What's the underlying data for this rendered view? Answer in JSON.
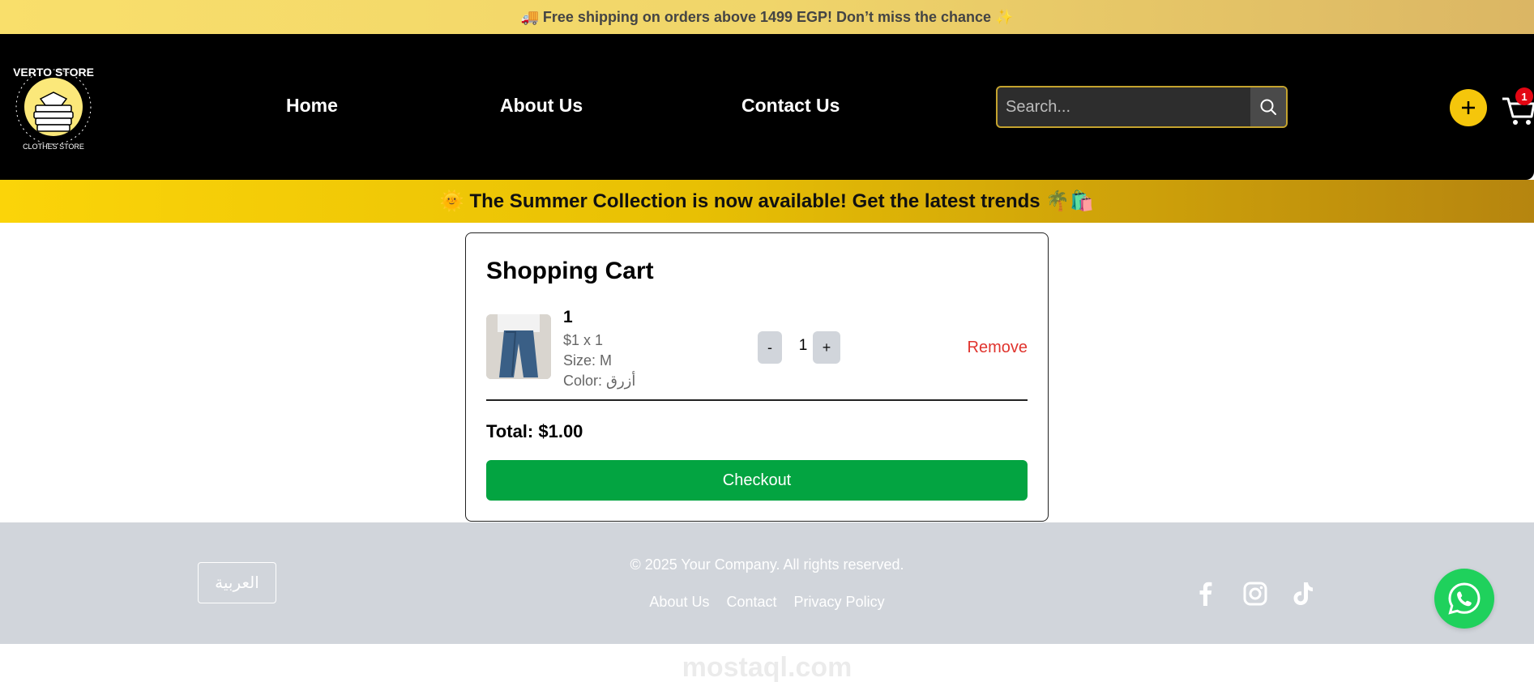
{
  "promo": {
    "text": "🚚 Free shipping on orders above 1499 EGP! Don’t miss the chance ✨"
  },
  "header": {
    "logo": {
      "top_text": "VERTO STORE",
      "bottom_text": "CLOTHES STORE"
    },
    "nav": [
      "Home",
      "About Us",
      "Contact Us"
    ],
    "search": {
      "placeholder": "Search..."
    },
    "cart_count": "1"
  },
  "banner": {
    "text": "🌞 The Summer Collection is now available! Get the latest trends 🌴🛍️"
  },
  "cart": {
    "title": "Shopping Cart",
    "item": {
      "name": "1",
      "price_line": "$1 x 1",
      "size_line": "Size: M",
      "color_line": "Color: أزرق",
      "quantity": "1",
      "minus": "-",
      "plus": "+",
      "remove": "Remove"
    },
    "total": "Total: $1.00",
    "checkout": "Checkout"
  },
  "footer": {
    "language": "العربية",
    "copyright": "© 2025 Your Company. All rights reserved.",
    "links": [
      "About Us",
      "Contact",
      "Privacy Policy"
    ],
    "social": [
      "facebook-icon",
      "instagram-icon",
      "tiktok-icon"
    ]
  },
  "watermark": "mostaql.com",
  "colors": {
    "accent": "#f5c60b",
    "checkout": "#03a441",
    "remove": "#e0342e",
    "whatsapp": "#1fd15c"
  }
}
